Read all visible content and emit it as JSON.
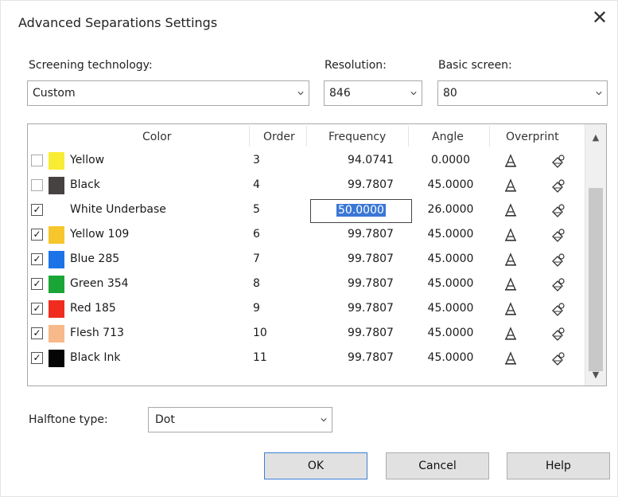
{
  "window": {
    "title": "Advanced Separations Settings",
    "close_glyph": "✕"
  },
  "screening": {
    "label": "Screening technology:",
    "value": "Custom"
  },
  "resolution": {
    "label": "Resolution:",
    "value": "846"
  },
  "basic_screen": {
    "label": "Basic screen:",
    "value": "80"
  },
  "columns": {
    "color": "Color",
    "order": "Order",
    "frequency": "Frequency",
    "angle": "Angle",
    "overprint": "Overprint"
  },
  "rows": [
    {
      "checked": false,
      "swatch": "#f9ec35",
      "name": "Yellow",
      "order": "3",
      "frequency": "94.0741",
      "angle": "0.0000"
    },
    {
      "checked": false,
      "swatch": "#464242",
      "name": "Black",
      "order": "4",
      "frequency": "99.7807",
      "angle": "45.0000"
    },
    {
      "checked": true,
      "swatch": "#ffffff",
      "name": "White Underbase",
      "order": "5",
      "frequency": "50.0000",
      "angle": "26.0000",
      "editing": true
    },
    {
      "checked": true,
      "swatch": "#f7c52c",
      "name": "Yellow 109",
      "order": "6",
      "frequency": "99.7807",
      "angle": "45.0000"
    },
    {
      "checked": true,
      "swatch": "#1c73e8",
      "name": "Blue 285",
      "order": "7",
      "frequency": "99.7807",
      "angle": "45.0000"
    },
    {
      "checked": true,
      "swatch": "#1aa636",
      "name": "Green 354",
      "order": "8",
      "frequency": "99.7807",
      "angle": "45.0000"
    },
    {
      "checked": true,
      "swatch": "#ef2c1e",
      "name": "Red 185",
      "order": "9",
      "frequency": "99.7807",
      "angle": "45.0000"
    },
    {
      "checked": true,
      "swatch": "#f7b989",
      "name": "Flesh 713",
      "order": "10",
      "frequency": "99.7807",
      "angle": "45.0000"
    },
    {
      "checked": true,
      "swatch": "#050505",
      "name": "Black Ink",
      "order": "11",
      "frequency": "99.7807",
      "angle": "45.0000"
    }
  ],
  "halftone": {
    "label": "Halftone type:",
    "value": "Dot"
  },
  "buttons": {
    "ok": "OK",
    "cancel": "Cancel",
    "help": "Help"
  },
  "icons": {
    "overprint_text": "overprint-text-icon",
    "overprint_graphics": "overprint-graphics-icon",
    "dropdown": "chevron-down-icon",
    "scroll_up": "scroll-up-icon",
    "scroll_down": "scroll-down-icon"
  },
  "colors": {
    "selection": "#3a77d6",
    "default_button_border": "#3c7fd4"
  }
}
